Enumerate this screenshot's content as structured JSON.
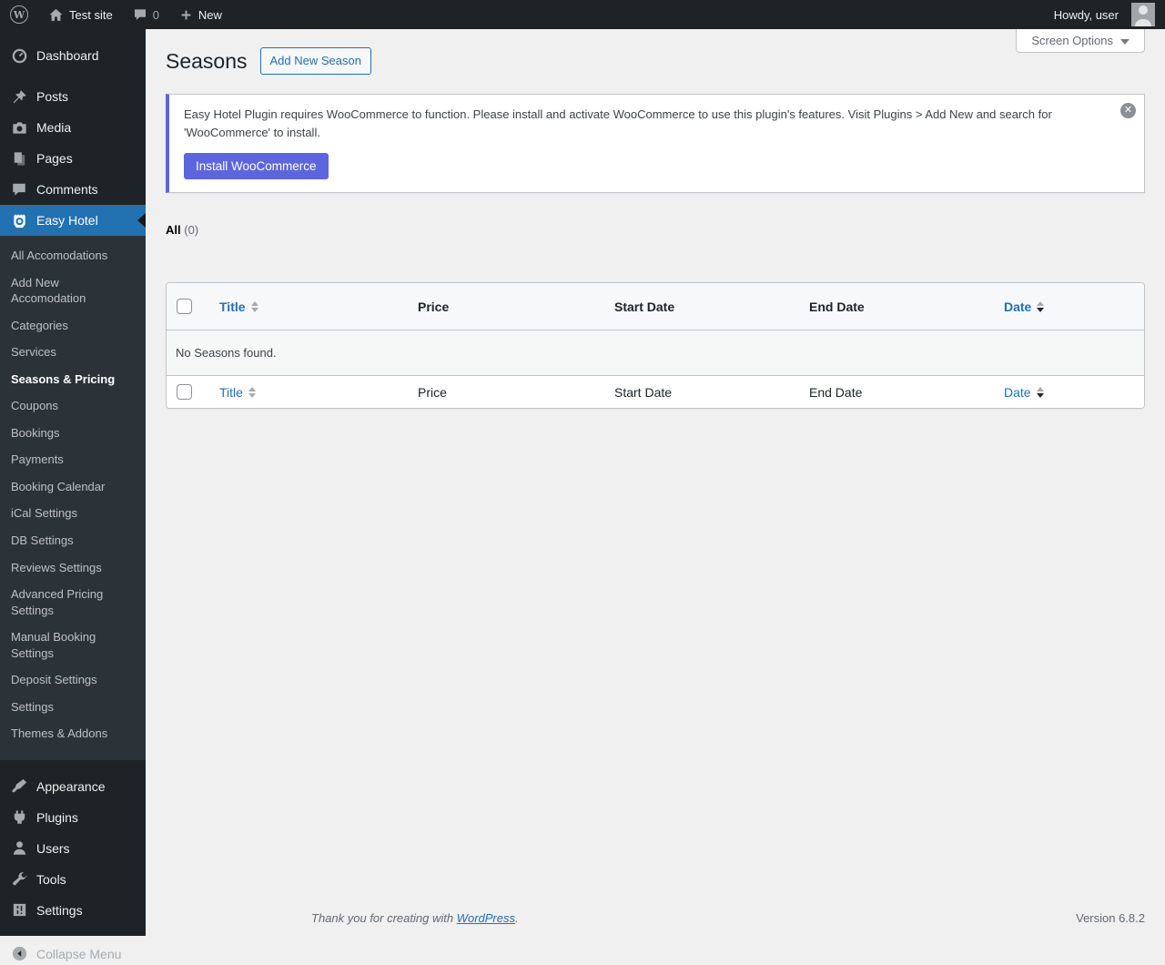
{
  "admin_bar": {
    "site_name": "Test site",
    "comments_count": "0",
    "new_label": "New",
    "howdy": "Howdy, user"
  },
  "sidebar": {
    "top_items": [
      {
        "label": "Dashboard",
        "icon": "dashboard-icon"
      },
      {
        "label": "Posts",
        "icon": "pushpin-icon"
      },
      {
        "label": "Media",
        "icon": "camera-icon"
      },
      {
        "label": "Pages",
        "icon": "pages-icon"
      },
      {
        "label": "Comments",
        "icon": "comment-bubble-icon"
      },
      {
        "label": "Easy Hotel",
        "icon": "easy-hotel-icon",
        "active": true
      }
    ],
    "submenu": [
      "All Accomodations",
      "Add New Accomodation",
      "Categories",
      "Services",
      "Seasons & Pricing",
      "Coupons",
      "Bookings",
      "Payments",
      "Booking Calendar",
      "iCal Settings",
      "DB Settings",
      "Reviews Settings",
      "Advanced Pricing Settings",
      "Manual Booking Settings",
      "Deposit Settings",
      "Settings",
      "Themes & Addons"
    ],
    "current_submenu": "Seasons & Pricing",
    "bottom_items": [
      {
        "label": "Appearance",
        "icon": "brush-icon"
      },
      {
        "label": "Plugins",
        "icon": "plug-icon"
      },
      {
        "label": "Users",
        "icon": "user-icon"
      },
      {
        "label": "Tools",
        "icon": "wrench-icon"
      },
      {
        "label": "Settings",
        "icon": "sliders-icon"
      }
    ],
    "collapse_label": "Collapse Menu"
  },
  "page": {
    "title": "Seasons",
    "add_new_label": "Add New Season",
    "screen_options_label": "Screen Options"
  },
  "notice": {
    "message": "Easy Hotel Plugin requires WooCommerce to function. Please install and activate WooCommerce to use this plugin's features. Visit Plugins > Add New and search for 'WooCommerce' to install.",
    "button_label": "Install WooCommerce",
    "dismiss_glyph": "✕"
  },
  "filters": {
    "all_label": "All",
    "all_count": "(0)"
  },
  "table": {
    "columns": [
      {
        "label": "Title",
        "sortable": true,
        "sorted": "none"
      },
      {
        "label": "Price",
        "sortable": false
      },
      {
        "label": "Start Date",
        "sortable": false
      },
      {
        "label": "End Date",
        "sortable": false
      },
      {
        "label": "Date",
        "sortable": true,
        "sorted": "desc"
      }
    ],
    "empty_message": "No Seasons found."
  },
  "footer": {
    "thanks_prefix": "Thank you for creating with ",
    "wordpress_link": "WordPress",
    "thanks_suffix": ".",
    "version": "Version 6.8.2"
  },
  "colors": {
    "admin_accent_blue": "#2271b1",
    "sidebar_bg": "#1d2327",
    "submenu_bg": "#2c3338",
    "notice_accent": "#5c64d8",
    "install_button": "#5c66dc",
    "content_bg": "#f0f0f1",
    "border_grey": "#c3c4c7"
  }
}
